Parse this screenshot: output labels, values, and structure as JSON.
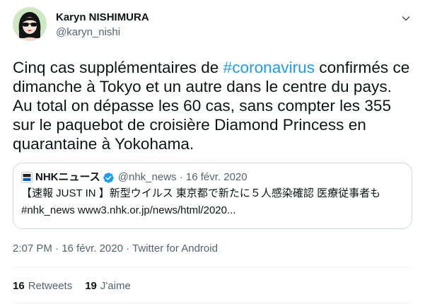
{
  "colors": {
    "text": "#0f1419",
    "secondary": "#536471",
    "link": "#1d9bf0",
    "border": "#cfd9de",
    "divider": "#eff3f4"
  },
  "tweet": {
    "author": {
      "name": "Karyn NISHIMURA",
      "handle": "@karyn_nishi",
      "avatar_icon": "avatar-icon"
    },
    "menu_icon": "chevron-down-icon",
    "text": {
      "before_hashtag": "Cinq cas supplémentaires de ",
      "hashtag": "#coronavirus",
      "after_hashtag": " confirmés ce dimanche à Tokyo et un autre dans le centre du pays. Au total on dépasse les 60 cas, sans compter les 355 sur le paquebot de croisière Diamond Princess en quarantaine à Yokohama."
    },
    "quoted_tweet": {
      "logo_icon": "nhk-news-logo-icon",
      "name": "NHKニュース",
      "verified": true,
      "verified_icon": "verified-badge-icon",
      "handle": "@nhk_news",
      "separator": "·",
      "date": "16 févr. 2020",
      "lines": [
        "【速報 JUST IN 】新型ウイルス 東京都で新たに５人感染確認 医療従事者も",
        "#nhk_news www3.nhk.or.jp/news/html/2020..."
      ]
    },
    "timestamp": {
      "time": "2:07 PM",
      "separator": "·",
      "date": "16 févr. 2020",
      "source": "Twitter for Android"
    },
    "stats": {
      "retweets": {
        "count": "16",
        "label": "Retweets"
      },
      "likes": {
        "count": "19",
        "label": "J'aime"
      }
    }
  }
}
